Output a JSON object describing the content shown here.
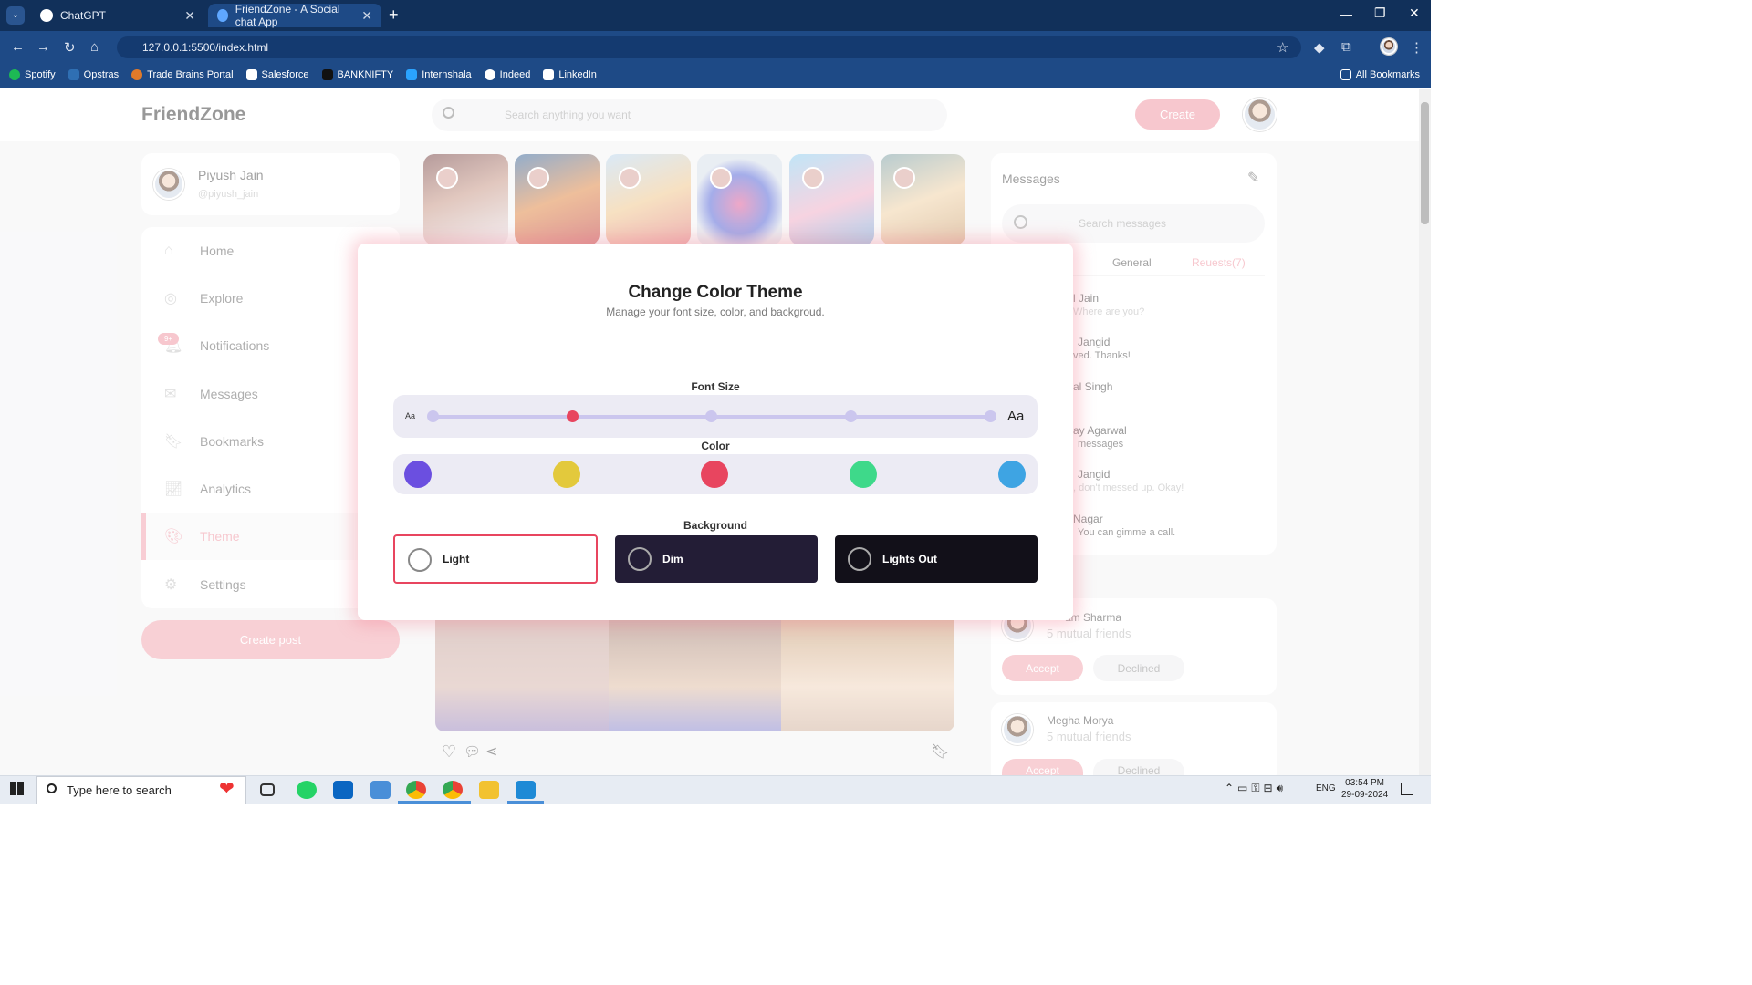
{
  "browser": {
    "tabs": [
      {
        "title": "ChatGPT",
        "active": false
      },
      {
        "title": "FriendZone - A Social chat App",
        "active": true
      }
    ],
    "url": "127.0.0.1:5500/index.html",
    "bookmarks": [
      "Spotify",
      "Opstras",
      "Trade Brains Portal",
      "Salesforce",
      "BANKNIFTY",
      "Internshala",
      "Indeed",
      "LinkedIn"
    ],
    "all_bookmarks": "All Bookmarks"
  },
  "app": {
    "logo": "FriendZone",
    "search_placeholder": "Search anything you want",
    "create_label": "Create",
    "accent": "#f09aa6"
  },
  "profile": {
    "name": "Piyush Jain",
    "handle": "@piyush_jain"
  },
  "menu": [
    {
      "label": "Home",
      "icon": "home-icon"
    },
    {
      "label": "Explore",
      "icon": "compass-icon"
    },
    {
      "label": "Notifications",
      "icon": "bell-icon",
      "badge": "9+"
    },
    {
      "label": "Messages",
      "icon": "envelope-icon"
    },
    {
      "label": "Bookmarks",
      "icon": "bookmark-icon"
    },
    {
      "label": "Analytics",
      "icon": "chart-icon"
    },
    {
      "label": "Theme",
      "icon": "palette-icon",
      "active": true
    },
    {
      "label": "Settings",
      "icon": "gear-icon"
    }
  ],
  "create_post": "Create post",
  "messages": {
    "title": "Messages",
    "search_placeholder": "Search messages",
    "tabs": [
      "General",
      "Reuests(7)"
    ],
    "items": [
      {
        "name": "l Jain",
        "text": "Where are you?"
      },
      {
        "name": "Jangid",
        "text": "ved. Thanks!"
      },
      {
        "name": "al Singh",
        "text": ""
      },
      {
        "name": "ay Agarwal",
        "text": "messages"
      },
      {
        "name": "Jangid",
        "text": ", don't messed up. Okay!"
      },
      {
        "name": "Nagar",
        "text": "You can gimme a call."
      }
    ]
  },
  "requests": [
    {
      "name": "am Sharma",
      "mutual": "5 mutual friends",
      "accept": "Accept",
      "decline": "Declined"
    },
    {
      "name": "Megha Morya",
      "mutual": "5 mutual friends",
      "accept": "Accept",
      "decline": "Declined"
    }
  ],
  "modal": {
    "title": "Change Color Theme",
    "subtitle": "Manage your font size, color, and backgroud.",
    "font_size_label": "Font Size",
    "font_small": "Aa",
    "font_large": "Aa",
    "font_levels": 5,
    "font_selected_index": 1,
    "color_label": "Color",
    "colors": [
      "#6b4fe0",
      "#e3c93c",
      "#e8455f",
      "#3ed98a",
      "#3ea4e3"
    ],
    "background_label": "Background",
    "backgrounds": [
      {
        "label": "Light",
        "selected": true
      },
      {
        "label": "Dim",
        "selected": false
      },
      {
        "label": "Lights Out",
        "selected": false
      }
    ]
  },
  "taskbar": {
    "search_placeholder": "Type here to search",
    "lang": "ENG",
    "time": "03:54 PM",
    "date": "29-09-2024"
  }
}
